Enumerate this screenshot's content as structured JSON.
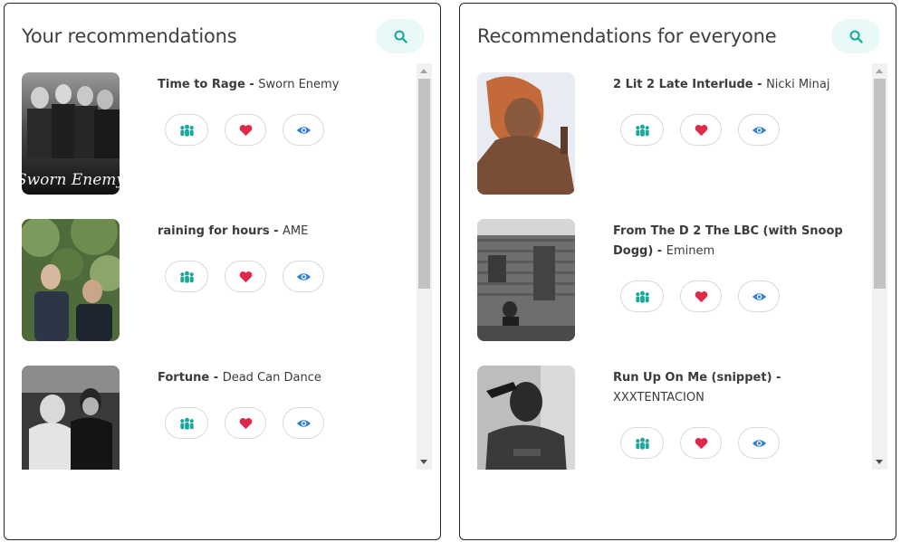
{
  "colors": {
    "accent_teal": "#1aa89a",
    "heart_red": "#e0284a",
    "eye_blue": "#2b7fd4",
    "search_bg": "#e9f9f7"
  },
  "panels": {
    "left": {
      "title": "Your recommendations",
      "search_icon": "search-icon",
      "items": [
        {
          "title": "Time to Rage",
          "separator": " - ",
          "artist": "Sworn Enemy",
          "cover_text": "Sworn Enemy"
        },
        {
          "title": "raining for hours",
          "separator": " - ",
          "artist": "AME"
        },
        {
          "title": "Fortune",
          "separator": " - ",
          "artist": "Dead Can Dance"
        }
      ]
    },
    "right": {
      "title": "Recommendations for everyone",
      "search_icon": "search-icon",
      "items": [
        {
          "title": "2 Lit 2 Late Interlude",
          "separator": " - ",
          "artist": "Nicki Minaj"
        },
        {
          "title": "From The D 2 The LBC (with Snoop Dogg)",
          "separator": " - ",
          "artist": "Eminem"
        },
        {
          "title": "Run Up On Me (snippet)",
          "separator": " - ",
          "artist": "XXXTENTACION"
        }
      ]
    }
  },
  "action_icons": [
    "group-icon",
    "heart-icon",
    "eye-icon"
  ]
}
